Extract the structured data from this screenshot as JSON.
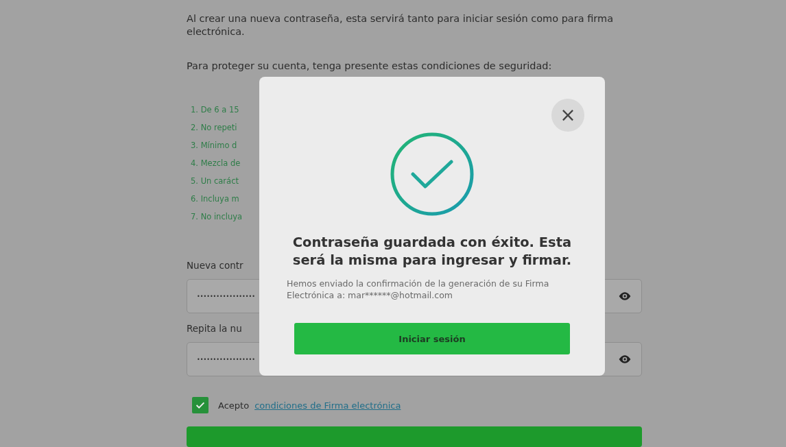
{
  "intro": "Al crear una nueva contraseña, esta servirá tanto para iniciar sesión como para firma electrónica.",
  "conditions_heading": "Para proteger su cuenta, tenga presente estas condiciones de seguridad:",
  "conditions": [
    "1. De 6 a 15",
    "2. No repeti",
    "3. Mínimo d",
    "4. Mezcla de",
    "5. Un caráct",
    "6. Incluya m",
    "7. No incluya"
  ],
  "fields": [
    {
      "label": "Nueva contr",
      "value": "••••••••••••••••••"
    },
    {
      "label": "Repita la nu",
      "value": "••••••••••••••••••"
    }
  ],
  "accept": {
    "checked": true,
    "text": "Acepto",
    "link": "condiciones de Firma electrónica"
  },
  "modal": {
    "close": "×",
    "title": "Contraseña guardada con éxito. Esta será la misma para ingresar y firmar.",
    "message": "Hemos enviado la confirmación de la generación de su Firma Electrónica a: mar******@hotmail.com",
    "button": "Iniciar sesión"
  }
}
